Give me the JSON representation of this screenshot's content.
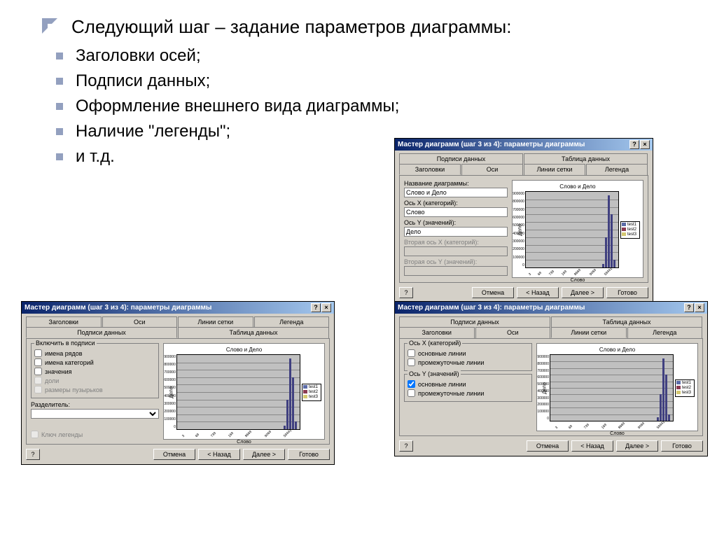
{
  "main_bullet": "Следующий шаг – задание параметров диаграммы:",
  "sub_bullets": [
    "Заголовки осей;",
    "Подписи данных;",
    "Оформление внешнего вида диаграммы;",
    "Наличие \"легенды\";",
    " и т.д."
  ],
  "dialog": {
    "title": "Мастер диаграмм (шаг 3 из 4): параметры диаграммы",
    "help_sym": "?",
    "close_sym": "×",
    "tabs": {
      "headers": "Заголовки",
      "axes": "Оси",
      "gridlines": "Линии сетки",
      "legend": "Легенда",
      "labels": "Подписи данных",
      "table": "Таблица данных"
    },
    "d1_fields": {
      "chart_title_label": "Название диаграммы:",
      "chart_title_value": "Слово и Дело",
      "x_label": "Ось X (категорий):",
      "x_value": "Слово",
      "y_label": "Ось Y (значений):",
      "y_value": "Дело",
      "x2_label": "Вторая ось X (категорий):",
      "y2_label": "Вторая ось Y (значений):"
    },
    "d2_options": {
      "group_title": "Включить в подписи",
      "opt1": "имена рядов",
      "opt2": "имена категорий",
      "opt3": "значения",
      "opt4": "доли",
      "opt5": "размеры пузырьков",
      "sep_label": "Разделитель:",
      "key": "Ключ легенды"
    },
    "d3_options": {
      "group_x": "Ось X (категорий)",
      "group_y": "Ось Y (значений)",
      "main_lines": "основные линии",
      "inter_lines": "промежуточные линии"
    },
    "preview": {
      "title": "Слово и Дело",
      "ylabel": "Дело",
      "xlabel": "Слово",
      "legend_items": [
        "test1",
        "test2",
        "test3"
      ],
      "legend_colors": [
        "#5b6ba8",
        "#8b3a52",
        "#d4c870"
      ],
      "y_ticks": [
        "900000",
        "800000",
        "700000",
        "600000",
        "500000",
        "400000",
        "300000",
        "200000",
        "100000",
        "0"
      ],
      "x_ticks": [
        "3",
        "69",
        "739",
        "169",
        "8669",
        "9069",
        "59441"
      ]
    },
    "buttons": {
      "help": "?",
      "cancel": "Отмена",
      "back": "< Назад",
      "next": "Далее >",
      "finish": "Готово"
    }
  },
  "chart_data": {
    "type": "bar",
    "title": "Слово и Дело",
    "xlabel": "Слово",
    "ylabel": "Дело",
    "ylim": [
      0,
      900000
    ],
    "categories": [
      "3",
      "69",
      "739",
      "169",
      "8669",
      "9069",
      "59441"
    ],
    "series": [
      {
        "name": "test1",
        "values": [
          0,
          0,
          0,
          0,
          50000,
          400000,
          900000
        ]
      },
      {
        "name": "test2",
        "values": [
          0,
          0,
          0,
          0,
          40000,
          300000,
          700000
        ]
      },
      {
        "name": "test3",
        "values": [
          0,
          0,
          0,
          0,
          30000,
          200000,
          100000
        ]
      }
    ]
  }
}
